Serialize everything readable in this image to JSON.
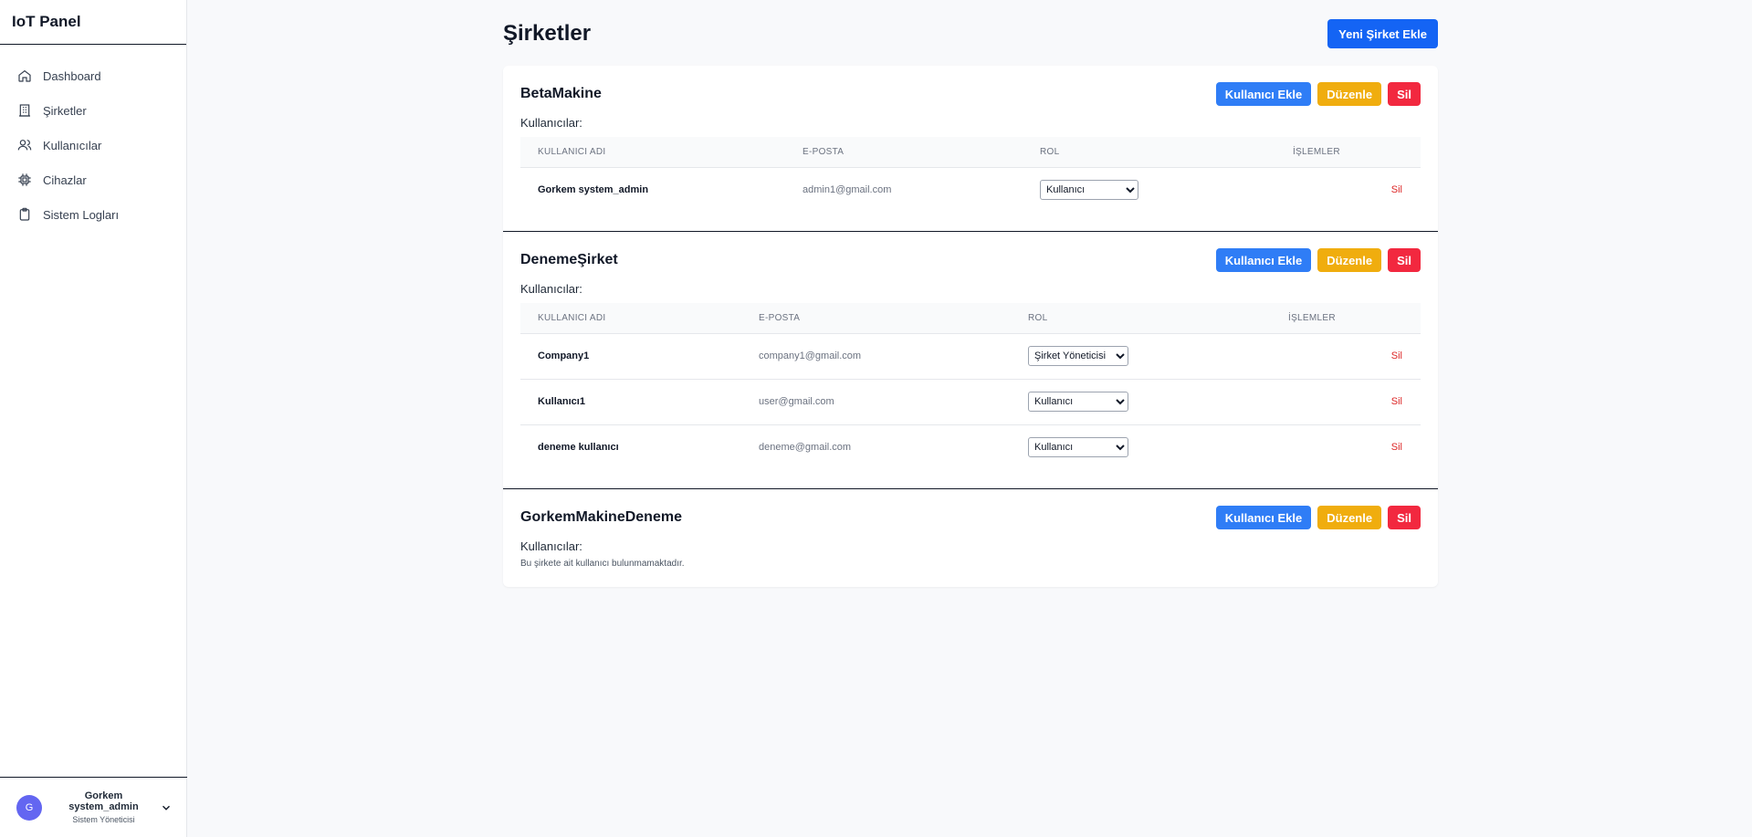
{
  "app": {
    "title": "IoT Panel"
  },
  "sidebar": {
    "items": [
      {
        "label": "Dashboard",
        "icon": "home-icon"
      },
      {
        "label": "Şirketler",
        "icon": "building-icon"
      },
      {
        "label": "Kullanıcılar",
        "icon": "users-icon"
      },
      {
        "label": "Cihazlar",
        "icon": "chip-icon"
      },
      {
        "label": "Sistem Logları",
        "icon": "clipboard-icon"
      }
    ],
    "user": {
      "initial": "G",
      "name": "Gorkem system_admin",
      "role": "Sistem Yöneticisi"
    }
  },
  "page": {
    "title": "Şirketler",
    "add_company_label": "Yeni Şirket Ekle"
  },
  "labels": {
    "add_user": "Kullanıcı Ekle",
    "edit": "Düzenle",
    "delete": "Sil",
    "users_heading": "Kullanıcılar:",
    "col_username": "KULLANICI ADI",
    "col_email": "E-POSTA",
    "col_role": "ROL",
    "col_actions": "İŞLEMLER",
    "row_delete": "Sil",
    "no_users": "Bu şirkete ait kullanıcı bulunmamaktadır."
  },
  "companies": [
    {
      "name": "BetaMakine",
      "users": [
        {
          "username": "Gorkem system_admin",
          "email": "admin1@gmail.com",
          "role": "Kullanıcı"
        }
      ]
    },
    {
      "name": "DenemeŞirket",
      "users": [
        {
          "username": "Company1",
          "email": "company1@gmail.com",
          "role": "Şirket Yöneticisi"
        },
        {
          "username": "Kullanıcı1",
          "email": "user@gmail.com",
          "role": "Kullanıcı"
        },
        {
          "username": "deneme kullanıcı",
          "email": "deneme@gmail.com",
          "role": "Kullanıcı"
        }
      ]
    },
    {
      "name": "GorkemMakineDeneme",
      "users": []
    }
  ],
  "colors": {
    "primary": "#1464f4",
    "blue": "#2f7df6",
    "yellow": "#f0ad0e",
    "red": "#f2283f",
    "avatar": "#6366f1"
  }
}
